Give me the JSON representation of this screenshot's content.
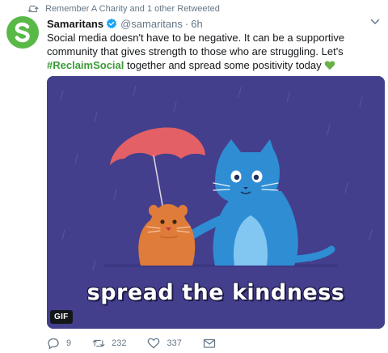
{
  "retweet_context": {
    "text": "Remember A Charity and 1 other Retweeted",
    "icon": "retweet-icon"
  },
  "tweet": {
    "author_name": "Samaritans",
    "handle": "@samaritans",
    "separator": "·",
    "time": "6h",
    "avatar_letter": "S",
    "avatar_color": "#58b947",
    "text_part1": "Social media doesn't have to be negative. It can be a supportive community that gives strength to those who are struggling. Let's ",
    "hashtag": "#ReclaimSocial",
    "text_part2": " together and spread some positivity today",
    "emoji": "green-heart-icon",
    "accent_color": "#3d9a3a"
  },
  "media": {
    "caption": "spread the kindness",
    "badge": "GIF",
    "background_color": "#433f8c"
  },
  "actions": {
    "reply_count": "9",
    "retweet_count": "232",
    "like_count": "337"
  }
}
